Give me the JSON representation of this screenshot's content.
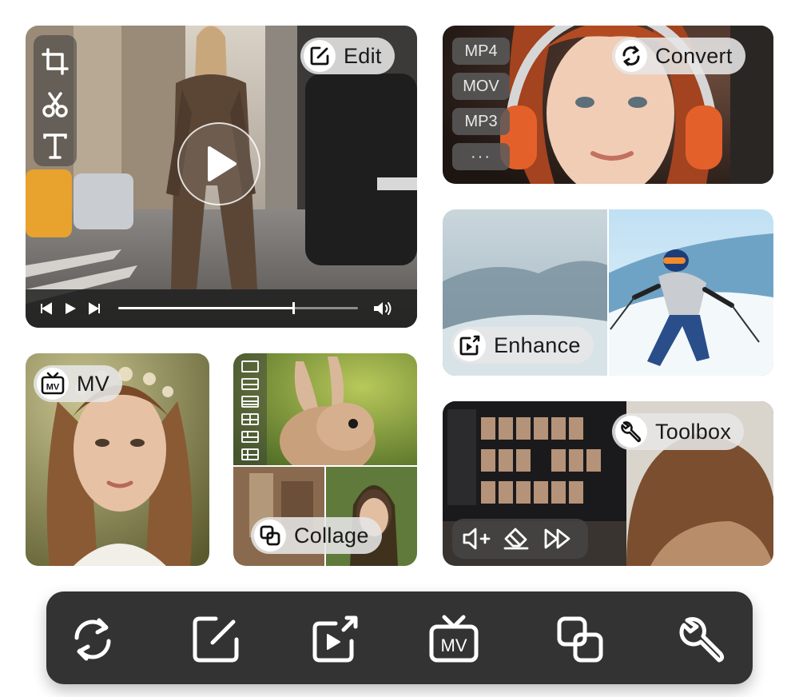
{
  "cards": {
    "edit": {
      "label": "Edit",
      "icon": "edit-icon"
    },
    "convert": {
      "label": "Convert",
      "icon": "convert-icon",
      "formats": [
        "MP4",
        "MOV",
        "MP3",
        "···"
      ]
    },
    "enhance": {
      "label": "Enhance",
      "icon": "enhance-icon"
    },
    "mv": {
      "label": "MV",
      "icon": "mv-icon"
    },
    "collage": {
      "label": "Collage",
      "icon": "collage-icon"
    },
    "toolbox": {
      "label": "Toolbox",
      "icon": "toolbox-icon"
    }
  },
  "mv_badge_text": "MV",
  "player": {
    "progress": 0.73
  },
  "dock": {
    "items": [
      "convert-icon",
      "edit-icon",
      "enhance-icon",
      "mv-icon",
      "collage-icon",
      "toolbox-icon"
    ]
  },
  "colors": {
    "dock": "#333333",
    "pill": "#e6e6e6",
    "accent_orange": "#e4602a"
  }
}
